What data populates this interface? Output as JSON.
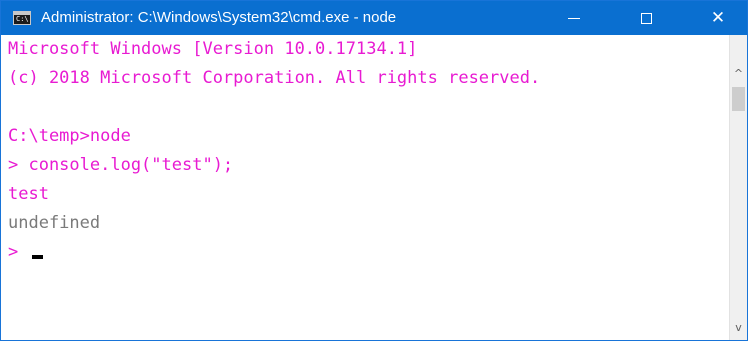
{
  "window": {
    "title": "Administrator: C:\\Windows\\System32\\cmd.exe - node",
    "icon_label": "C:\\",
    "icon": "cmd-icon",
    "accent": "#0a6fd0"
  },
  "controls": {
    "minimize_icon": "minimize-icon",
    "maximize_icon": "maximize-icon",
    "close_icon": "close-icon",
    "close_glyph": "✕"
  },
  "console": {
    "colors": {
      "prompt": "#e81bd2",
      "output": "#7a7a7a",
      "cursor": "#000000"
    },
    "lines": [
      {
        "text": "Microsoft Windows [Version 10.0.17134.1]"
      },
      {
        "text": "(c) 2018 Microsoft Corporation. All rights reserved."
      },
      {
        "text": ""
      },
      {
        "text": "C:\\temp>node"
      },
      {
        "text": "> console.log(\"test\");"
      },
      {
        "text": "test"
      },
      {
        "text": "undefined"
      },
      {
        "text": ">"
      }
    ]
  },
  "scrollbar": {
    "up_glyph": "^",
    "down_glyph": "v"
  }
}
